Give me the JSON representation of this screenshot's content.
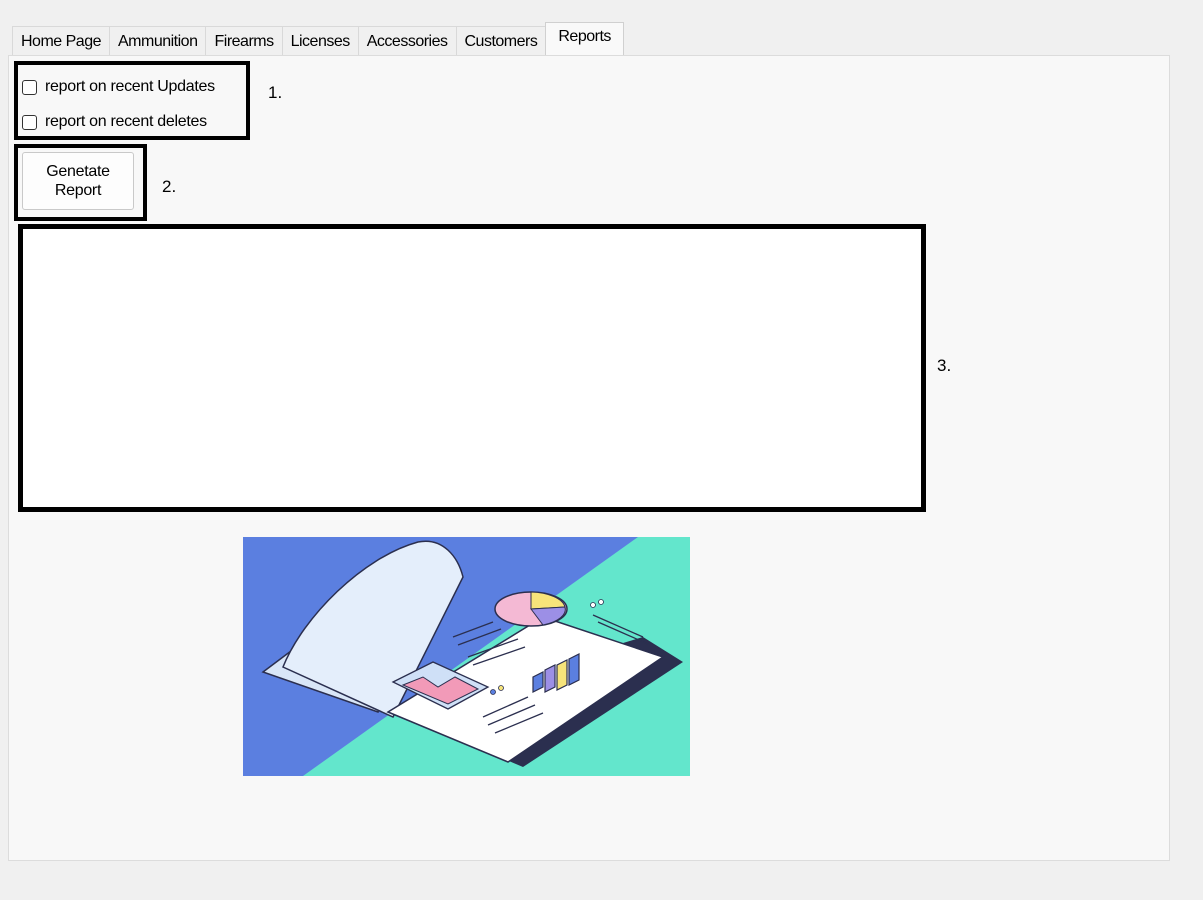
{
  "tabs": [
    "Home Page",
    "Ammunition",
    "Firearms",
    "Licenses",
    "Accessories",
    "Customers",
    "Reports"
  ],
  "active_tab": "Reports",
  "options": {
    "recent_updates_label": "report on recent Updates",
    "recent_updates_checked": false,
    "recent_deletes_label": "report on recent deletes",
    "recent_deletes_checked": false
  },
  "generate_button": {
    "line1": "Genetate",
    "line2": "Report"
  },
  "annotations": {
    "one": "1.",
    "two": "2.",
    "three": "3."
  },
  "report_output": "",
  "colors": {
    "illustration_blue": "#5b7fe0",
    "illustration_teal": "#63e6cc",
    "annotation_border": "#000000"
  },
  "illustration_icon": "report-book-chart-illustration"
}
